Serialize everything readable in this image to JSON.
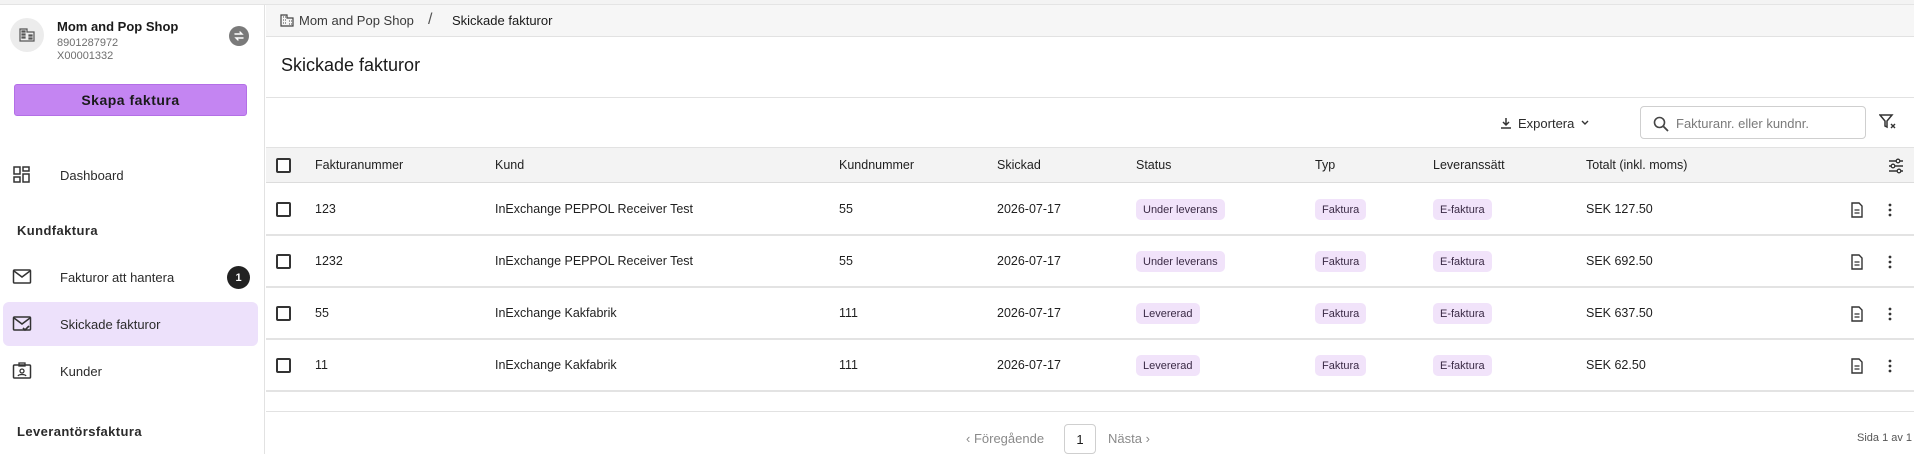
{
  "org": {
    "name": "Mom and Pop Shop",
    "number": "8901287972",
    "id": "X00001332"
  },
  "create_button": "Skapa faktura",
  "nav": {
    "dashboard": "Dashboard",
    "section_customer": "Kundfaktura",
    "to_handle": "Fakturor att hantera",
    "to_handle_badge": "1",
    "sent": "Skickade fakturor",
    "customers": "Kunder",
    "section_supplier": "Leverantörsfaktura"
  },
  "breadcrumb": {
    "home": "Mom and Pop Shop",
    "separator": "/",
    "current": "Skickade fakturor"
  },
  "page_title": "Skickade fakturor",
  "toolbar": {
    "export": "Exportera",
    "search_placeholder": "Fakturanr. eller kundnr."
  },
  "table": {
    "headers": [
      "Fakturanummer",
      "Kund",
      "Kundnummer",
      "Skickad",
      "Status",
      "Typ",
      "Leveranssätt",
      "Totalt (inkl. moms)"
    ],
    "rows": [
      {
        "number": "123",
        "customer": "InExchange PEPPOL Receiver Test",
        "customer_number": "55",
        "sent": "2026-07-17",
        "status": "Under leverans",
        "type": "Faktura",
        "delivery": "E-faktura",
        "total": "SEK 127.50"
      },
      {
        "number": "1232",
        "customer": "InExchange PEPPOL Receiver Test",
        "customer_number": "55",
        "sent": "2026-07-17",
        "status": "Under leverans",
        "type": "Faktura",
        "delivery": "E-faktura",
        "total": "SEK 692.50"
      },
      {
        "number": "55",
        "customer": "InExchange Kakfabrik",
        "customer_number": "111",
        "sent": "2026-07-17",
        "status": "Levererad",
        "type": "Faktura",
        "delivery": "E-faktura",
        "total": "SEK 637.50"
      },
      {
        "number": "11",
        "customer": "InExchange Kakfabrik",
        "customer_number": "111",
        "sent": "2026-07-17",
        "status": "Levererad",
        "type": "Faktura",
        "delivery": "E-faktura",
        "total": "SEK 62.50"
      }
    ]
  },
  "pagination": {
    "prev": "Föregående",
    "page": "1",
    "next": "Nästa",
    "info": "Sida 1 av 1"
  },
  "colors": {
    "accent": "#c485f2",
    "active_nav": "#ede1fb",
    "chip": "#f1e3fa"
  }
}
